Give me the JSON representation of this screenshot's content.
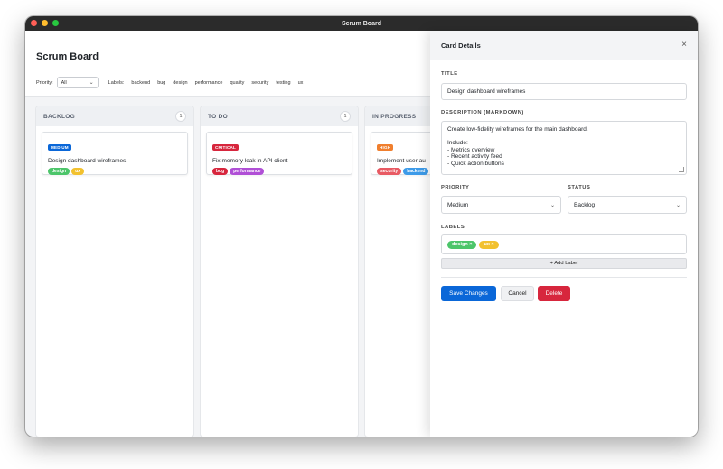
{
  "window": {
    "title": "Scrum Board"
  },
  "app": {
    "title": "Scrum Board"
  },
  "filters": {
    "priority_label": "Priority:",
    "priority_value": "All",
    "labels_label": "Labels:",
    "labels": [
      "backend",
      "bug",
      "design",
      "performance",
      "quality",
      "security",
      "testing",
      "ux"
    ]
  },
  "columns": [
    {
      "title": "BACKLOG",
      "count": "1",
      "card": {
        "priority": "MEDIUM",
        "priority_color": "#0a67d8",
        "title": "Design dashboard wireframes",
        "tags": [
          {
            "label": "design",
            "color": "#4cc56a"
          },
          {
            "label": "ux",
            "color": "#f2c12e"
          }
        ]
      }
    },
    {
      "title": "TO DO",
      "count": "1",
      "card": {
        "priority": "CRITICAL",
        "priority_color": "#d7263d",
        "title": "Fix memory leak in API client",
        "tags": [
          {
            "label": "bug",
            "color": "#d7263d"
          },
          {
            "label": "performance",
            "color": "#b04fd6"
          }
        ]
      }
    },
    {
      "title": "IN PROGRESS",
      "count": "",
      "card": {
        "priority": "HIGH",
        "priority_color": "#f07f2e",
        "title": "Implement user au",
        "tags": [
          {
            "label": "security",
            "color": "#e85a63"
          },
          {
            "label": "backend",
            "color": "#3d9be9"
          }
        ]
      }
    }
  ],
  "panel": {
    "title": "Card Details",
    "close_glyph": "×",
    "title_label": "TITLE",
    "title_value": "Design dashboard wireframes",
    "description_label": "DESCRIPTION (MARKDOWN)",
    "description_value": "Create low-fidelity wireframes for the main dashboard.\n\nInclude:\n- Metrics overview\n- Recent activity feed\n- Quick action buttons",
    "priority_label": "PRIORITY",
    "priority_value": "Medium",
    "status_label": "STATUS",
    "status_value": "Backlog",
    "labels_label": "LABELS",
    "labels": [
      {
        "label": "design ×",
        "color": "#4cc56a"
      },
      {
        "label": "ux ×",
        "color": "#f2c12e"
      }
    ],
    "add_label": "+ Add Label",
    "save_label": "Save Changes",
    "cancel_label": "Cancel",
    "delete_label": "Delete"
  }
}
